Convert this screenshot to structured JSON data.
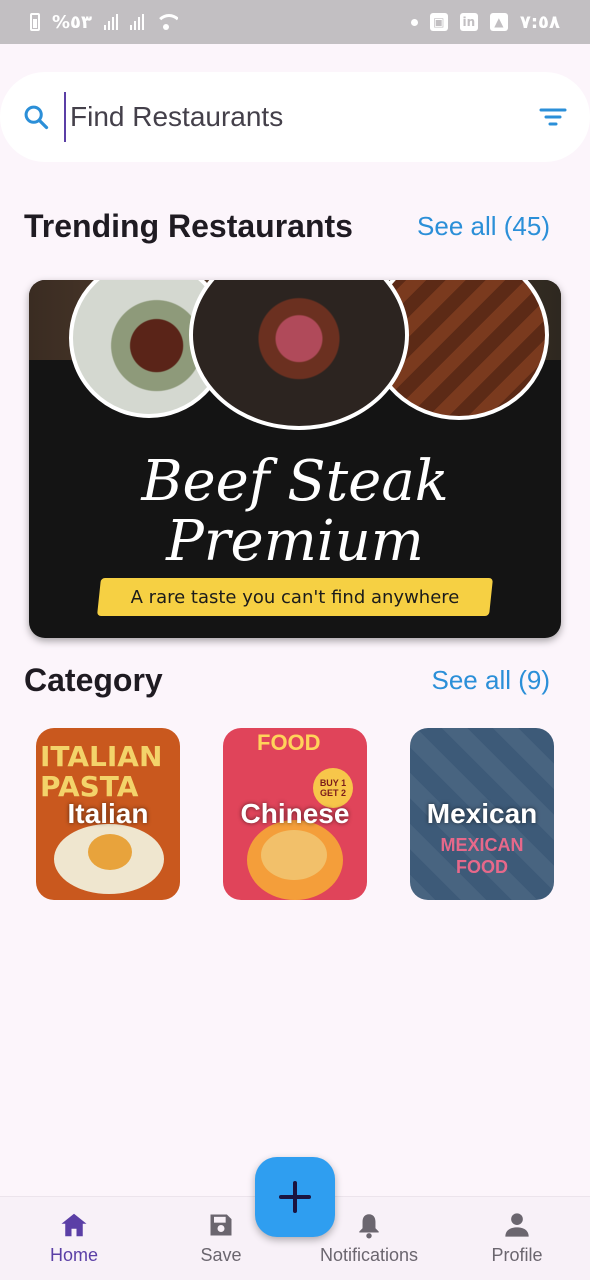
{
  "status_bar": {
    "left_text": "%٥٣",
    "time": "٧:٥٨",
    "linkedin_label": "in"
  },
  "search": {
    "placeholder": "Find Restaurants"
  },
  "trending": {
    "title": "Trending Restaurants",
    "see_all": "See all (45)",
    "banner": {
      "title_line1": "Beef Steak",
      "title_line2": "Premium",
      "tagline": "A rare taste you can't find anywhere"
    }
  },
  "category": {
    "title": "Category",
    "see_all": "See all (9)",
    "items": [
      {
        "label": "Italian",
        "art_text": "ITALIAN PASTA"
      },
      {
        "label": "Chinese",
        "art_text": "FOOD",
        "badge": "BUY 1 GET 2"
      },
      {
        "label": "Mexican",
        "art_text": "MEXICAN FOOD"
      }
    ]
  },
  "bottom_nav": {
    "items": [
      {
        "label": "Home",
        "icon": "home-icon",
        "active": true
      },
      {
        "label": "Save",
        "icon": "save-icon"
      },
      {
        "label": "Notifications",
        "icon": "bell-icon"
      },
      {
        "label": "Profile",
        "icon": "person-icon"
      }
    ]
  },
  "colors": {
    "accent_blue": "#2b8fd8",
    "active_purple": "#5b3fa6",
    "fab_blue": "#2f9ef0",
    "background": "#fcf5fb"
  }
}
